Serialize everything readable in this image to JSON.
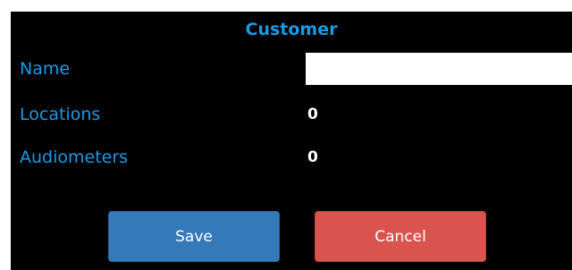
{
  "dialog": {
    "title": "Customer"
  },
  "fields": {
    "name_label": "Name",
    "name_value": "",
    "locations_label": "Locations",
    "locations_value": "0",
    "audiometers_label": "Audiometers",
    "audiometers_value": "0"
  },
  "actions": {
    "save_label": "Save",
    "cancel_label": "Cancel"
  },
  "colors": {
    "background": "#000000",
    "label": "#1a9ae6",
    "value": "#ffffff",
    "save_button": "#357ab8",
    "cancel_button": "#d9534f"
  }
}
